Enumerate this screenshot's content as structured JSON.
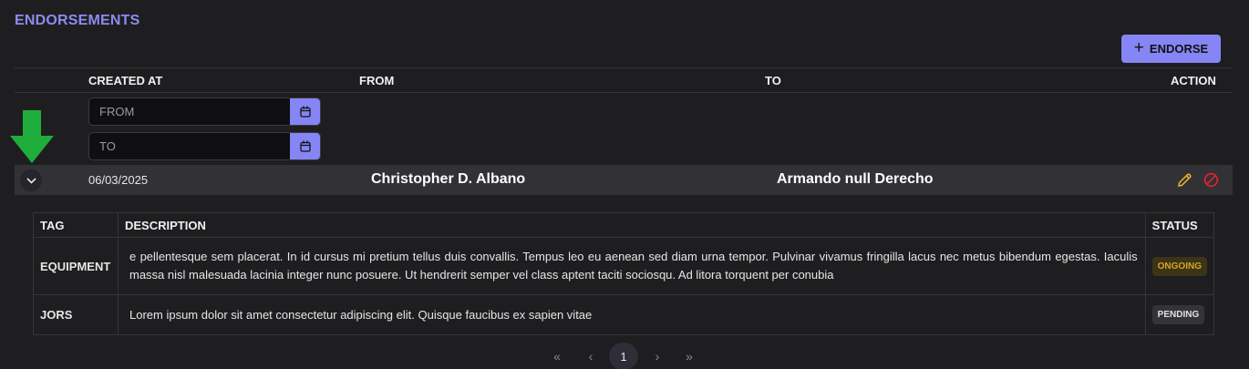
{
  "page": {
    "title": "ENDORSEMENTS"
  },
  "toolbar": {
    "endorse_label": "ENDORSE"
  },
  "table": {
    "headers": {
      "created_at": "CREATED AT",
      "from": "FROM",
      "to": "TO",
      "action": "ACTION"
    },
    "filters": {
      "from_placeholder": "FROM",
      "to_placeholder": "TO"
    },
    "row": {
      "date": "06/03/2025",
      "from": "Christopher D. Albano",
      "to": "Armando null Derecho"
    }
  },
  "detail": {
    "headers": {
      "tag": "TAG",
      "description": "DESCRIPTION",
      "status": "STATUS"
    },
    "rows": [
      {
        "tag": "EQUIPMENT",
        "description": "e pellentesque sem placerat. In id cursus mi pretium tellus duis convallis. Tempus leo eu aenean sed diam urna tempor. Pulvinar vivamus fringilla lacus nec metus bibendum egestas. Iaculis massa nisl malesuada lacinia integer nunc posuere. Ut hendrerit semper vel class aptent taciti sociosqu. Ad litora torquent per conubia",
        "status": "ONGOING"
      },
      {
        "tag": "JORS",
        "description": "Lorem ipsum dolor sit amet consectetur adipiscing elit. Quisque faucibus ex sapien vitae",
        "status": "PENDING"
      }
    ]
  },
  "pagination": {
    "first": "«",
    "prev": "‹",
    "current": "1",
    "next": "›",
    "last": "»"
  },
  "colors": {
    "accent": "#8585f5",
    "ongoing": "#d7a520",
    "edit": "#e6b82a",
    "delete": "#e0242f",
    "arrow": "#1fae3c"
  }
}
